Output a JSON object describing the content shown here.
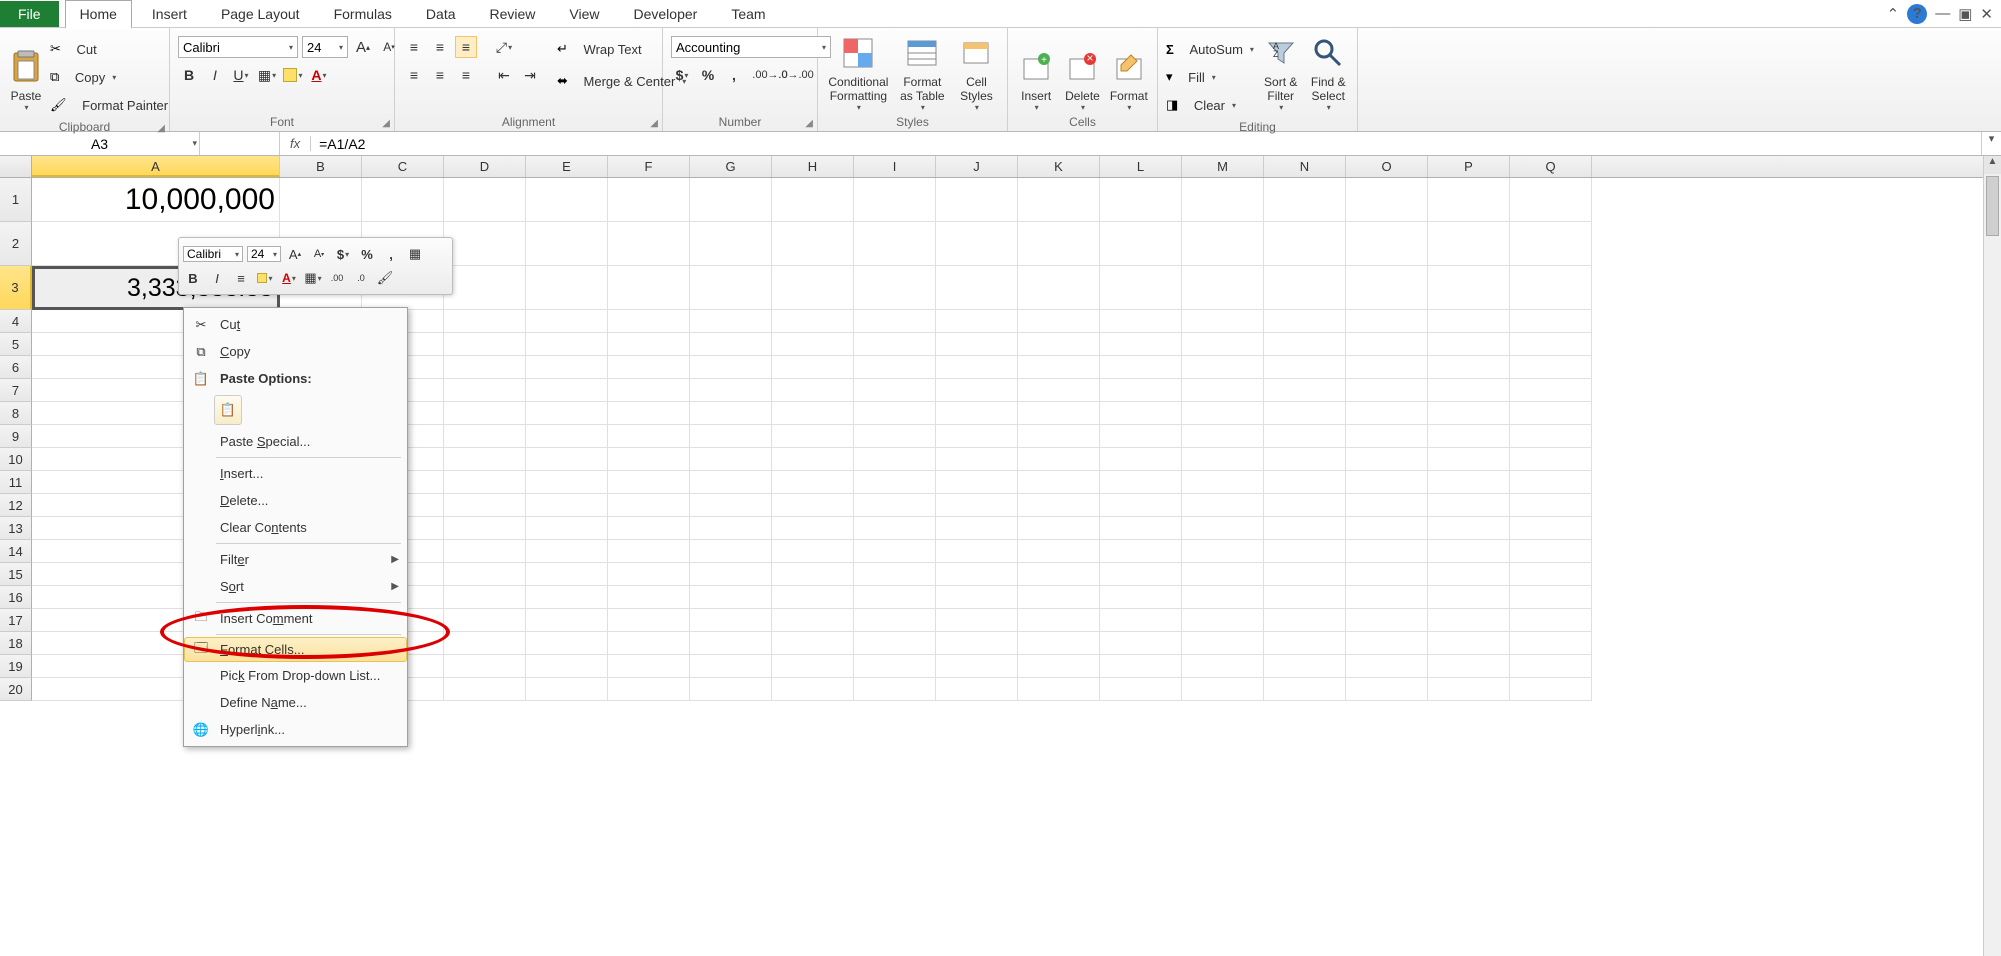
{
  "tabs": {
    "file": "File",
    "home": "Home",
    "insert": "Insert",
    "page_layout": "Page Layout",
    "formulas": "Formulas",
    "data": "Data",
    "review": "Review",
    "view": "View",
    "developer": "Developer",
    "team": "Team"
  },
  "ribbon": {
    "clipboard": {
      "title": "Clipboard",
      "paste": "Paste",
      "cut": "Cut",
      "copy": "Copy",
      "format_painter": "Format Painter"
    },
    "font": {
      "title": "Font",
      "name": "Calibri",
      "size": "24"
    },
    "alignment": {
      "title": "Alignment",
      "wrap": "Wrap Text",
      "merge": "Merge & Center"
    },
    "number": {
      "title": "Number",
      "format": "Accounting"
    },
    "styles": {
      "title": "Styles",
      "cond": "Conditional Formatting",
      "table": "Format as Table",
      "cell": "Cell Styles"
    },
    "cells": {
      "title": "Cells",
      "insert": "Insert",
      "delete": "Delete",
      "format": "Format"
    },
    "editing": {
      "title": "Editing",
      "autosum": "AutoSum",
      "fill": "Fill",
      "clear": "Clear",
      "sort": "Sort & Filter",
      "find": "Find & Select"
    }
  },
  "name_box": "A3",
  "formula": "=A1/A2",
  "columns": [
    "A",
    "B",
    "C",
    "D",
    "E",
    "F",
    "G",
    "H",
    "I",
    "J",
    "K",
    "L",
    "M",
    "N",
    "O",
    "P",
    "Q"
  ],
  "cells": {
    "A1": "10,000,000",
    "A3": "3,333,333.33"
  },
  "a3_visible": "3,333,333.33",
  "mini": {
    "font": "Calibri",
    "size": "24"
  },
  "ctx": {
    "cut": "Cut",
    "copy": "Copy",
    "paste_options": "Paste Options:",
    "paste_special": "Paste Special...",
    "insert": "Insert...",
    "delete": "Delete...",
    "clear": "Clear Contents",
    "filter": "Filter",
    "sort": "Sort",
    "insert_comment": "Insert Comment",
    "format_cells": "Format Cells...",
    "pick": "Pick From Drop-down List...",
    "define_name": "Define Name...",
    "hyperlink": "Hyperlink..."
  }
}
